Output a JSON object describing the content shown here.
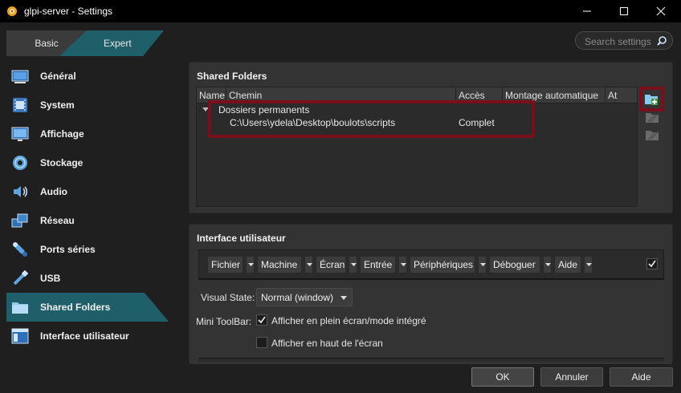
{
  "window": {
    "title": "glpi-server - Settings"
  },
  "mode_tabs": {
    "basic": "Basic",
    "expert": "Expert"
  },
  "search": {
    "placeholder": "Search settings"
  },
  "sidebar": {
    "items": [
      {
        "label": "Général",
        "icon": "general-icon"
      },
      {
        "label": "System",
        "icon": "system-icon"
      },
      {
        "label": "Affichage",
        "icon": "display-icon"
      },
      {
        "label": "Stockage",
        "icon": "storage-icon"
      },
      {
        "label": "Audio",
        "icon": "audio-icon"
      },
      {
        "label": "Réseau",
        "icon": "network-icon"
      },
      {
        "label": "Ports séries",
        "icon": "serial-ports-icon"
      },
      {
        "label": "USB",
        "icon": "usb-icon"
      },
      {
        "label": "Shared Folders",
        "icon": "shared-folders-icon",
        "selected": true
      },
      {
        "label": "Interface utilisateur",
        "icon": "user-interface-icon"
      }
    ]
  },
  "shared_folders": {
    "title": "Shared Folders",
    "columns": [
      "Name",
      "Chemin",
      "Accès",
      "Montage automatique",
      "At"
    ],
    "group_label": "Dossiers permanents",
    "rows": [
      {
        "name": "",
        "path": "C:\\Users\\ydela\\Desktop\\boulots\\scripts",
        "access": "Complet"
      }
    ],
    "highlight_color": "#7a0f1c"
  },
  "user_interface": {
    "title": "Interface utilisateur",
    "menu_items": [
      "Fichier",
      "Machine",
      "Écran",
      "Entrée",
      "Périphériques",
      "Déboguer",
      "Aide"
    ],
    "menubar_enabled": true,
    "visual_state_label": "Visual State:",
    "visual_state_value": "Normal (window)",
    "mini_toolbar_label": "Mini ToolBar:",
    "mini_toolbar_fullscreen": {
      "label": "Afficher en plein écran/mode intégré",
      "checked": true
    },
    "mini_toolbar_top": {
      "label": "Afficher en haut de l'écran",
      "checked": false
    }
  },
  "buttons": {
    "ok": "OK",
    "cancel": "Annuler",
    "help": "Aide"
  },
  "colors": {
    "accent": "#1f5f69",
    "background": "#1f1f1f",
    "panel": "#333333"
  }
}
